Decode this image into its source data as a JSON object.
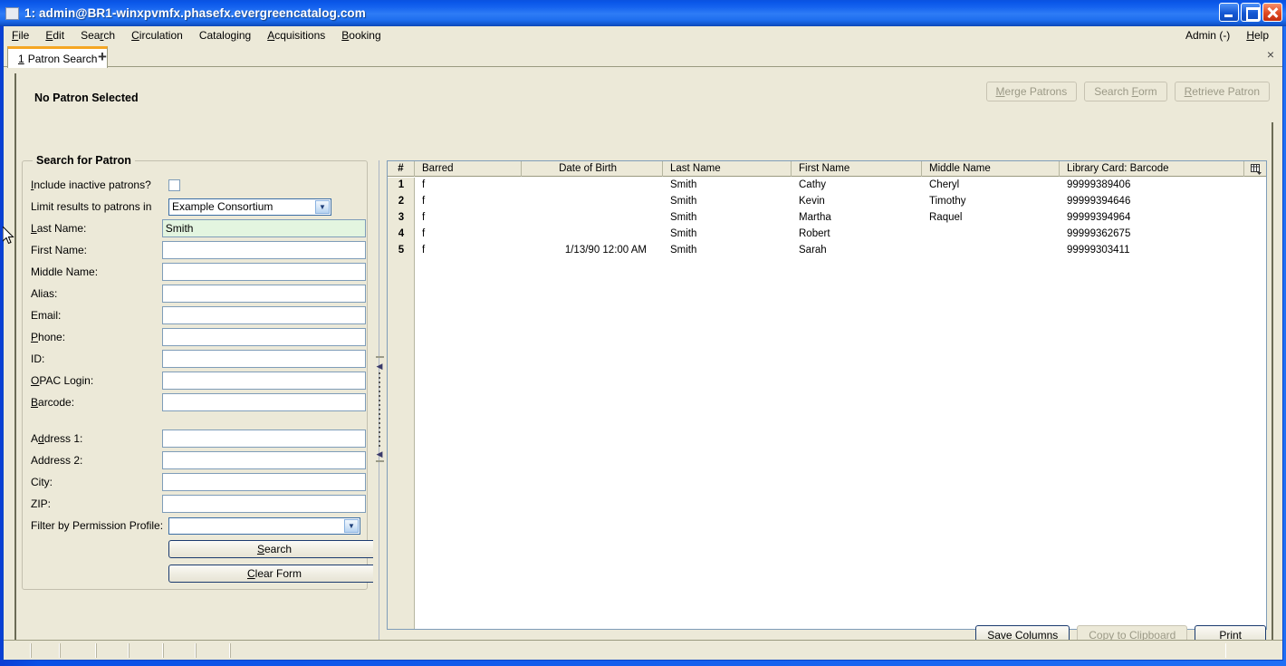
{
  "window": {
    "title": "1: admin@BR1-winxpvmfx.phasefx.evergreencatalog.com",
    "icon": "app-window-icon",
    "minimize_label": "",
    "maximize_label": "",
    "close_label": ""
  },
  "menubar": {
    "items": [
      {
        "label": "File",
        "accel": "F"
      },
      {
        "label": "Edit",
        "accel": "E"
      },
      {
        "label": "Search",
        "accel": "r"
      },
      {
        "label": "Circulation",
        "accel": "C"
      },
      {
        "label": "Cataloging",
        "accel": "g"
      },
      {
        "label": "Acquisitions",
        "accel": "A"
      },
      {
        "label": "Booking",
        "accel": "B"
      }
    ],
    "right_items": [
      {
        "label": "Admin (-)",
        "accel": ""
      },
      {
        "label": "Help",
        "accel": "H"
      }
    ]
  },
  "tabs": {
    "active": "1 Patron Search",
    "active_number": "1",
    "active_name": "Patron Search",
    "add_label": "+",
    "close_label": "×"
  },
  "patron_header": {
    "status": "No Patron Selected",
    "buttons": [
      {
        "label": "Merge Patrons",
        "enabled": false
      },
      {
        "label": "Search Form",
        "enabled": false
      },
      {
        "label": "Retrieve Patron",
        "enabled": false
      }
    ]
  },
  "search_form": {
    "legend": "Search for Patron",
    "fields": [
      {
        "label": "Include inactive patrons?",
        "type": "checkbox",
        "checked": false,
        "value": ""
      },
      {
        "label": "Limit results to patrons in",
        "type": "combo",
        "value": "Example Consortium"
      },
      {
        "label": "Last Name:",
        "type": "text",
        "value": "Smith",
        "focused": true
      },
      {
        "label": "First Name:",
        "type": "text",
        "value": "",
        "focused": false
      },
      {
        "label": "Middle Name:",
        "type": "text",
        "value": "",
        "focused": false
      },
      {
        "label": "Alias:",
        "type": "text",
        "value": "",
        "focused": false
      },
      {
        "label": "Email:",
        "type": "text",
        "value": "",
        "focused": false
      },
      {
        "label": "Phone:",
        "type": "text",
        "value": "",
        "focused": false
      },
      {
        "label": "ID:",
        "type": "text",
        "value": "",
        "focused": false
      },
      {
        "label": "OPAC Login:",
        "type": "text",
        "value": "",
        "focused": false
      },
      {
        "label": "Barcode:",
        "type": "text",
        "value": "",
        "focused": false
      },
      {
        "label": "Address 1:",
        "type": "text",
        "value": "",
        "focused": false
      },
      {
        "label": "Address 2:",
        "type": "text",
        "value": "",
        "focused": false
      },
      {
        "label": "City:",
        "type": "text",
        "value": "",
        "focused": false
      },
      {
        "label": "ZIP:",
        "type": "text",
        "value": "",
        "focused": false
      },
      {
        "label": "Filter by Permission Profile:",
        "type": "combo",
        "value": ""
      }
    ],
    "search_button": "Search",
    "clear_button": "Clear Form"
  },
  "results_grid": {
    "columns": [
      {
        "label": "#",
        "align": "center"
      },
      {
        "label": "Barred",
        "align": "left"
      },
      {
        "label": "Date of Birth",
        "align": "right"
      },
      {
        "label": "Last Name",
        "align": "left"
      },
      {
        "label": "First Name",
        "align": "left"
      },
      {
        "label": "Middle Name",
        "align": "left"
      },
      {
        "label": "Library Card: Barcode",
        "align": "left"
      }
    ],
    "column_picker_icon": "column-picker-icon",
    "rows": [
      {
        "num": "1",
        "barred": "f",
        "dob": "",
        "last": "Smith",
        "first": "Cathy",
        "middle": "Cheryl",
        "barcode": "99999389406"
      },
      {
        "num": "2",
        "barred": "f",
        "dob": "",
        "last": "Smith",
        "first": "Kevin",
        "middle": "Timothy",
        "barcode": "99999394646"
      },
      {
        "num": "3",
        "barred": "f",
        "dob": "",
        "last": "Smith",
        "first": "Martha",
        "middle": "Raquel",
        "barcode": "99999394964"
      },
      {
        "num": "4",
        "barred": "f",
        "dob": "",
        "last": "Smith",
        "first": "Robert",
        "middle": "",
        "barcode": "99999362675"
      },
      {
        "num": "5",
        "barred": "f",
        "dob": "1/13/90 12:00 AM",
        "last": "Smith",
        "first": "Sarah",
        "middle": "",
        "barcode": "99999303411"
      }
    ],
    "buttons": [
      {
        "label": "Save Columns",
        "enabled": true
      },
      {
        "label": "Copy to Clipboard",
        "enabled": false
      },
      {
        "label": "Print",
        "enabled": true
      }
    ]
  },
  "statusbar": {
    "cells": [
      "",
      "",
      "",
      "",
      "",
      "",
      ""
    ]
  },
  "colors": {
    "titlebar_blue": "#0a52e0",
    "window_face": "#ece9d8",
    "tab_accent": "#f5a623",
    "focused_field": "#e3f5e0",
    "field_border": "#7f9db9",
    "default_button_border": "#1b3b6f",
    "disabled_text": "#9b9986"
  }
}
